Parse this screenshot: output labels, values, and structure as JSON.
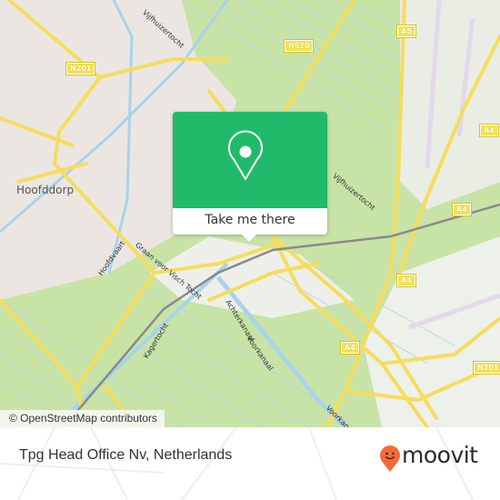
{
  "map": {
    "place_labels": {
      "hoofddorp": "Hoofddorp"
    },
    "road_shields": {
      "n201_top": "N201",
      "n520": "N520",
      "a5": "A5",
      "a4_top": "A4",
      "a4_mid": "A4",
      "a4_lower": "A4",
      "a4_bottom": "A4",
      "n201_right": "N201"
    },
    "street_labels": {
      "vijfhuizertocht_top": "Vijfhuizertocht",
      "vijfhuizertocht_mid": "Vijfhuizertocht",
      "hoofdvaart": "Hoofdvaart",
      "graan_voor_visch_tocht": "Graan voor Visch Tocht",
      "kagertocht": "Kagertocht",
      "achterkanaal": "Achterkanaal",
      "voorkanaal": "Voorkanaal",
      "voorkanaal_lower": "Voorkanaal"
    },
    "attribution": "© OpenStreetMap contributors",
    "colors": {
      "farmland": "#c8e3a6",
      "urban": "#ece8e4",
      "water": "#a9d3ea",
      "road": "#f5dd5c",
      "runway": "#e3d8ec",
      "rail": "#888888"
    }
  },
  "popup": {
    "icon": "map-pin-icon",
    "label": "Take me there",
    "color": "#21ba6a"
  },
  "footer": {
    "title": "Tpg Head Office Nv, Netherlands",
    "brand": "moovit",
    "brand_icon": "moovit-smiley-pin-icon",
    "brand_color": "#f26a3a"
  }
}
